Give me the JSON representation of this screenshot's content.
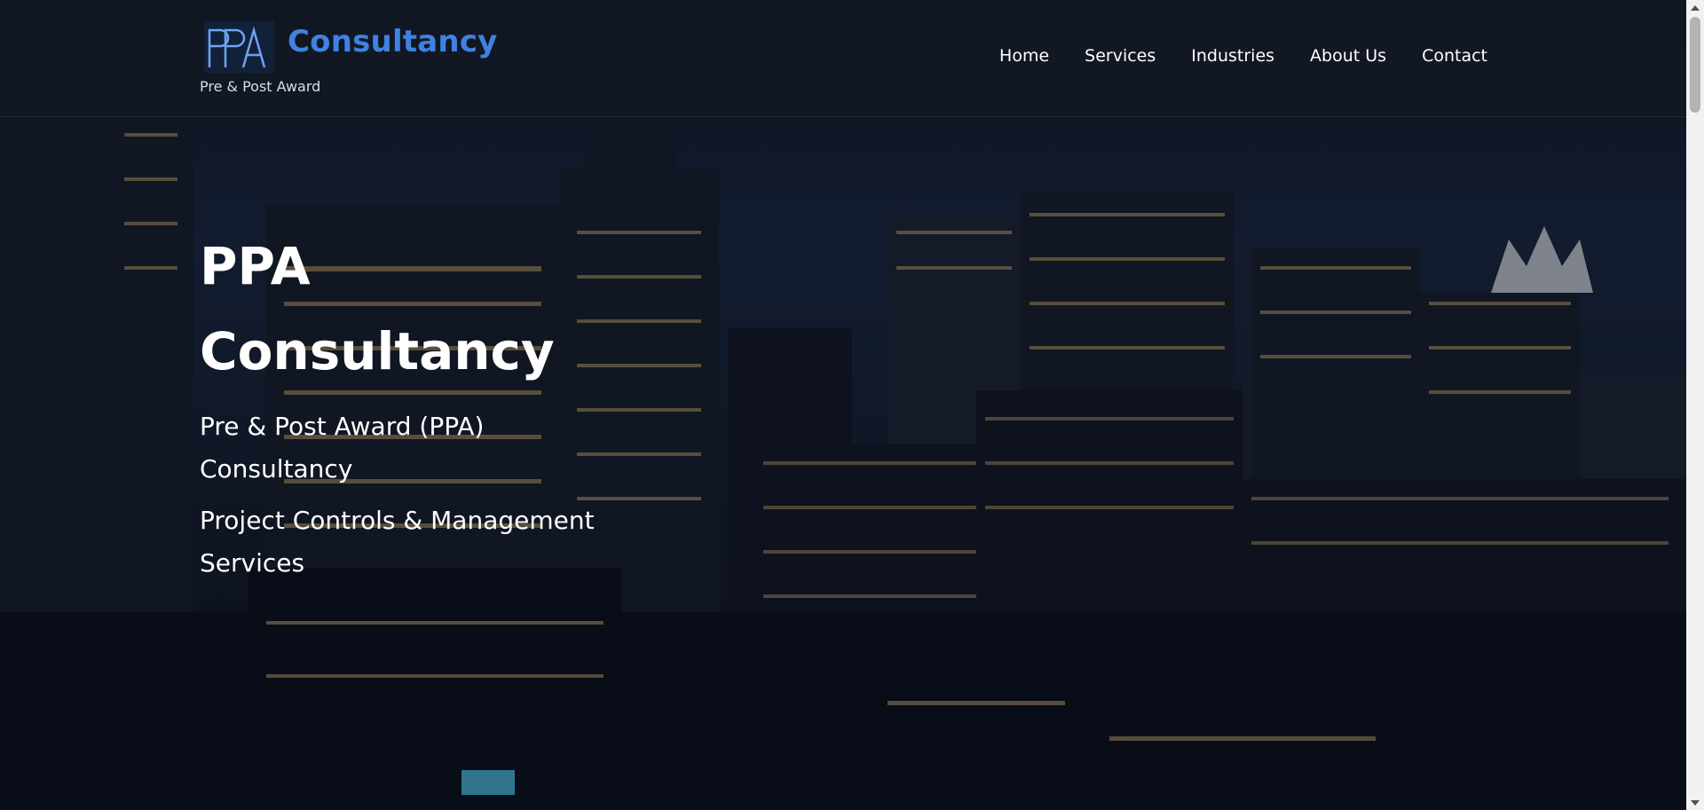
{
  "brand": {
    "logo_text": "PPA",
    "name": "Consultancy",
    "tagline": "Pre & Post Award"
  },
  "nav": {
    "items": [
      {
        "label": "Home"
      },
      {
        "label": "Services"
      },
      {
        "label": "Industries"
      },
      {
        "label": "About Us"
      },
      {
        "label": "Contact"
      }
    ]
  },
  "hero": {
    "title_line1": "PPA",
    "title_line2": "Consultancy",
    "line1": "Pre & Post Award (PPA) Consultancy",
    "line2": "Project Controls & Management Services",
    "background": "night-city-skyline-image"
  },
  "colors": {
    "brand_blue": "#3f82e0",
    "header_bg": "#111824",
    "text_white": "#ffffff"
  },
  "icons": {
    "scroll_up": "triangle-up-icon",
    "scroll_down": "triangle-down-icon"
  }
}
